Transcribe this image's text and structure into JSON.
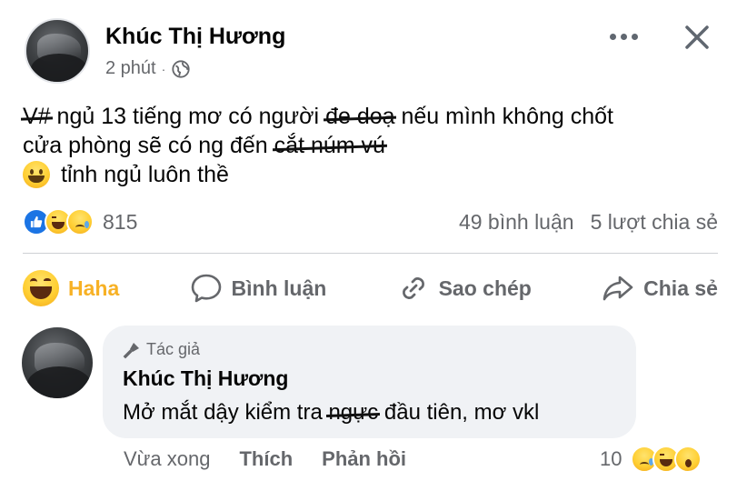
{
  "post": {
    "author": "Khúc Thị Hương",
    "time": "2 phút",
    "dot": "·",
    "text": {
      "line1_strike_start": "V#",
      "line1_a": " ngủ 13 tiếng mơ có người ",
      "line1_strike_mid": "đe doạ",
      "line1_b": " nếu mình không chốt",
      "line2_a": "cửa phòng sẽ có ng đến ",
      "line2_strike": "cắt núm vú",
      "line3": "tỉnh ngủ luôn thề"
    }
  },
  "stats": {
    "reaction_count": "815",
    "comments": "49 bình luận",
    "shares": "5 lượt chia sẻ"
  },
  "actions": {
    "haha": "Haha",
    "comment": "Bình luận",
    "copy": "Sao chép",
    "share": "Chia sẻ"
  },
  "comment": {
    "badge": "Tác giả",
    "author": "Khúc Thị Hương",
    "text_a": "Mở mắt dậy kiểm tra ",
    "text_strike": "ngực",
    "text_b": " đầu tiên, mơ vkl",
    "time": "Vừa xong",
    "like": "Thích",
    "reply": "Phản hồi",
    "reaction_count": "10"
  },
  "colors": {
    "accent_haha": "#f7b125",
    "like_blue": "#1b74e4",
    "muted": "#65676b",
    "bubble": "#f0f2f5"
  },
  "icons": [
    "more-icon",
    "close-icon",
    "globe-icon",
    "comment-icon",
    "copy-link-icon",
    "share-icon",
    "mic-icon"
  ]
}
